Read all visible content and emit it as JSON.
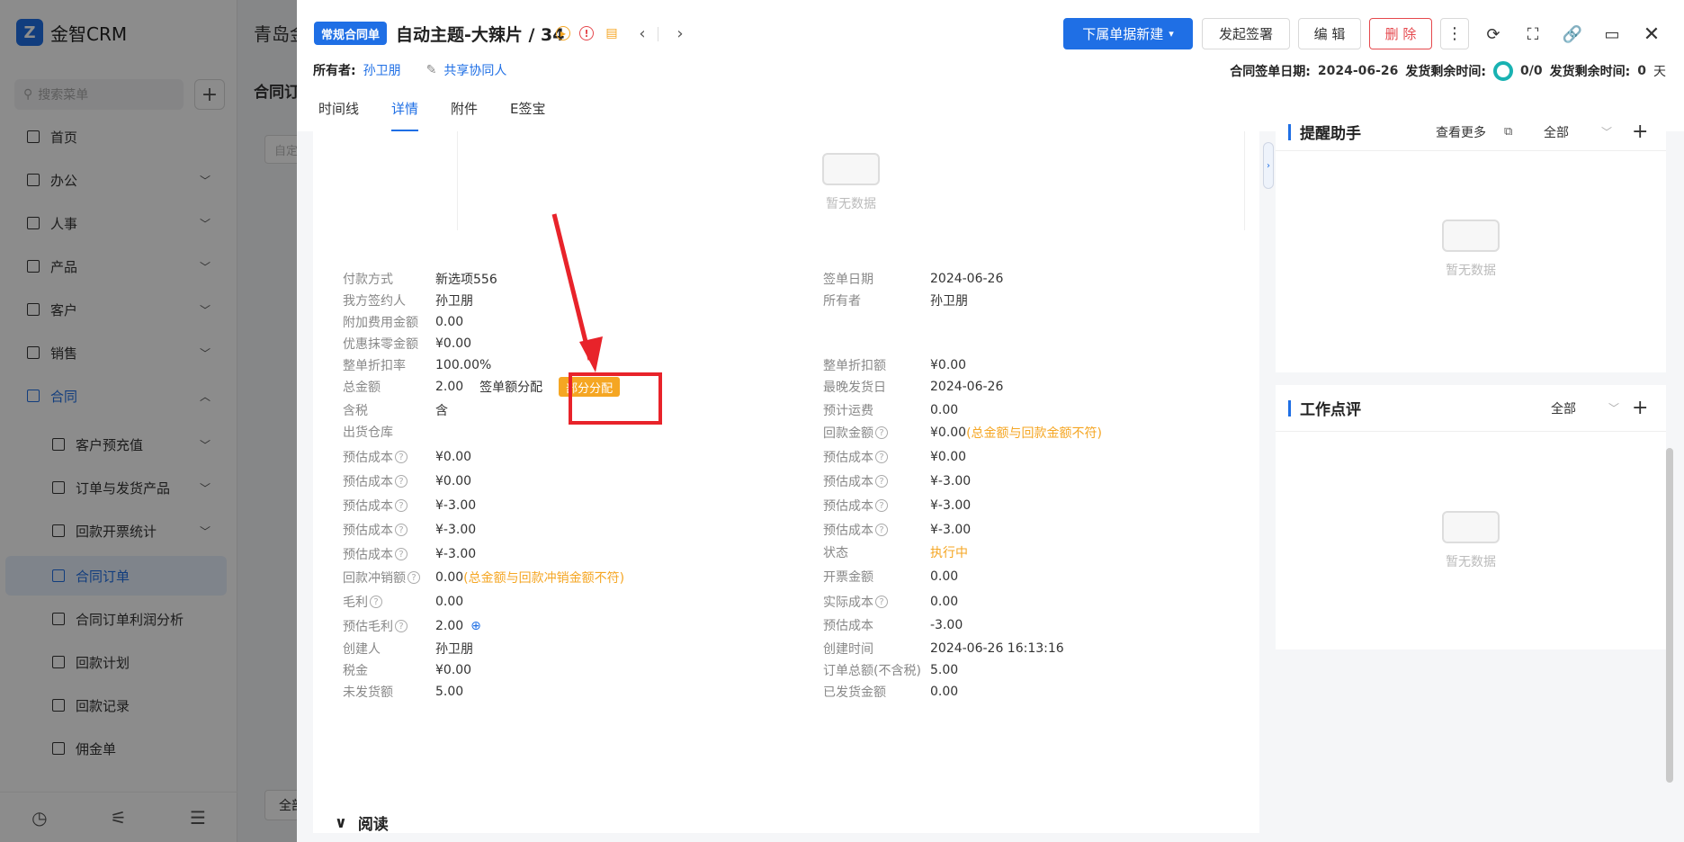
{
  "app": {
    "brand": "金智CRM",
    "logo_letter": "Z"
  },
  "sidebar": {
    "search_placeholder": "搜索菜单",
    "items": [
      {
        "label": "首页"
      },
      {
        "label": "办公"
      },
      {
        "label": "人事"
      },
      {
        "label": "产品"
      },
      {
        "label": "客户"
      },
      {
        "label": "销售"
      },
      {
        "label": "合同"
      },
      {
        "label": "客户预充值"
      },
      {
        "label": "订单与发货产品"
      },
      {
        "label": "回款开票统计"
      },
      {
        "label": "合同订单"
      },
      {
        "label": "合同订单利润分析"
      },
      {
        "label": "回款计划"
      },
      {
        "label": "回款记录"
      },
      {
        "label": "佣金单"
      }
    ]
  },
  "background": {
    "title": "青岛金",
    "tab": "合同订",
    "filter_placeholder": "自定",
    "footer_button": "全部"
  },
  "drawer": {
    "type_badge": "常规合同单",
    "title": "自动主题-大辣片 / 34",
    "buttons": {
      "create_below": "下属单据新建",
      "start_sign": "发起签署",
      "edit": "编 辑",
      "delete": "删 除"
    },
    "owner_label": "所有者:",
    "owner_value": "孙卫朋",
    "share_label": "共享协同人",
    "sign_date_label": "合同签单日期:",
    "sign_date_value": "2024-06-26",
    "ship_remain_label": "发货剩余时间:",
    "ship_remain_ratio": "0/0",
    "ship_remain_label2": "发货剩余时间:",
    "ship_remain_days": "0",
    "days_unit": "天",
    "tabs": [
      "时间线",
      "详情",
      "附件",
      "E签宝"
    ],
    "active_tab": "详情"
  },
  "details": {
    "empty_text": "暂无数据",
    "left": [
      {
        "label": "付款方式",
        "value": "新选项556"
      },
      {
        "label": "我方签约人",
        "value": "孙卫朋"
      },
      {
        "label": "附加费用金额",
        "value": "0.00"
      },
      {
        "label": "优惠抹零金额",
        "value": "¥0.00"
      },
      {
        "label": "整单折扣率",
        "value": "100.00%"
      },
      {
        "label": "总金额",
        "value": "2.00",
        "extra": "签单额分配",
        "tag": "部分分配"
      },
      {
        "label": "含税",
        "value": "含"
      },
      {
        "label": "出货仓库",
        "value": ""
      },
      {
        "label": "预估成本",
        "value": "¥0.00"
      },
      {
        "label": "预估成本",
        "value": "¥0.00"
      },
      {
        "label": "预估成本",
        "value": "¥-3.00"
      },
      {
        "label": "预估成本",
        "value": "¥-3.00"
      },
      {
        "label": "预估成本",
        "value": "¥-3.00"
      },
      {
        "label": "回款冲销额",
        "value": "0.00",
        "warn": "(总金额与回款冲销金额不符)"
      },
      {
        "label": "毛利",
        "value": "0.00"
      },
      {
        "label": "预估毛利",
        "value": "2.00"
      },
      {
        "label": "创建人",
        "value": "孙卫朋"
      },
      {
        "label": "税金",
        "value": "¥0.00"
      },
      {
        "label": "未发货额",
        "value": "5.00"
      }
    ],
    "right": [
      {
        "label": "签单日期",
        "value": "2024-06-26"
      },
      {
        "label": "所有者",
        "value": "孙卫朋"
      },
      {
        "label": "整单折扣额",
        "value": "¥0.00"
      },
      {
        "label": "最晚发货日",
        "value": "2024-06-26"
      },
      {
        "label": "预计运费",
        "value": "0.00"
      },
      {
        "label": "回款金额",
        "value": "¥0.00",
        "warn": "(总金额与回款金额不符)"
      },
      {
        "label": "预估成本",
        "value": "¥0.00"
      },
      {
        "label": "预估成本",
        "value": "¥-3.00"
      },
      {
        "label": "预估成本",
        "value": "¥-3.00"
      },
      {
        "label": "预估成本",
        "value": "¥-3.00"
      },
      {
        "label": "状态",
        "value": "执行中"
      },
      {
        "label": "开票金额",
        "value": "0.00"
      },
      {
        "label": "实际成本",
        "value": "0.00"
      },
      {
        "label": "预估成本",
        "value": "-3.00"
      },
      {
        "label": "创建时间",
        "value": "2024-06-26 16:13:16"
      },
      {
        "label": "订单总额(不含税)",
        "value": "5.00"
      },
      {
        "label": "已发货金额",
        "value": "0.00"
      }
    ],
    "read_section": "阅读"
  },
  "panels": {
    "reminder": {
      "title": "提醒助手",
      "more": "查看更多",
      "filter": "全部",
      "empty": "暂无数据"
    },
    "review": {
      "title": "工作点评",
      "filter": "全部",
      "empty": "暂无数据"
    }
  },
  "colors": {
    "primary": "#1f6fe5",
    "danger": "#e5484d",
    "warn": "#f5a623",
    "annotation": "#e8232a"
  }
}
